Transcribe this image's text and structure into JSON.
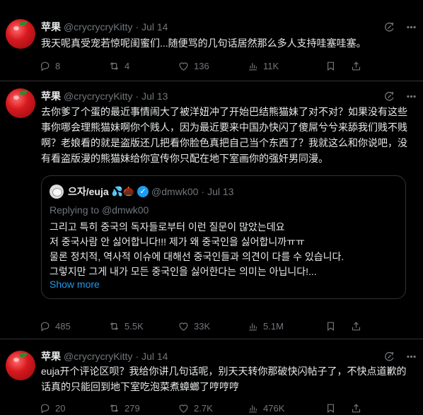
{
  "tweets": [
    {
      "name": "苹果",
      "handle": "@crycrycryKitty",
      "sep": "·",
      "date": "Jul 14",
      "text": "我天呢真受宠若惊呢闺蜜们...随便骂的几句话居然那么多人支持哇塞哇塞。",
      "replies": "8",
      "retweets": "4",
      "likes": "136",
      "views": "11K"
    },
    {
      "name": "苹果",
      "handle": "@crycrycryKitty",
      "sep": "·",
      "date": "Jul 13",
      "text": "去你爹了个蛋的最近事情闹大了被洋妞冲了开始巴结熊猫妹了对不对？如果没有这些事你哪会理熊猫妹啊你个贱人，因为最近要来中国办快闪了傻屌兮兮来舔我们贱不贱啊？老娘看的就是盗版还几把看你脸色真把自己当个东西了？我就这么和你说吧，没有看盗版漫的熊猫妹给你宣传你只配在地下室画你的强奸男同漫。",
      "quote": {
        "name": "으자/euja",
        "emoji": "💦🌰",
        "handle": "@dmwk00",
        "sep": "·",
        "date": "Jul 13",
        "reply_prefix": "Replying to",
        "reply_to": "@dmwk00",
        "lines": [
          "그리고 특히 중국의 독자들로부터 이런 질문이 많았는데요",
          "저 중국사람 안 싫어합니다!!! 제가 왜 중국인을 싫어합니까ㅠㅠ",
          "물론 정치적, 역사적 이슈에 대해선 중국인들과 의견이 다를 수 있습니다.",
          "그렇지만 그게 내가 모든 중국인을 싫어한다는 의미는 아닙니다!..."
        ],
        "show_more": "Show more"
      },
      "replies": "485",
      "retweets": "5.5K",
      "likes": "33K",
      "views": "5.1M"
    },
    {
      "name": "苹果",
      "handle": "@crycrycryKitty",
      "sep": "·",
      "date": "Jul 14",
      "text": "euja开个评论区呗？我给你讲几句话呢，别天天转你那破快闪帖子了，不快点道歉的话真的只能回到地下室吃泡菜煮蟑螂了哼哼哼",
      "replies": "20",
      "retweets": "279",
      "likes": "2.7K",
      "views": "476K"
    }
  ],
  "icons": {
    "reply": "reply-icon",
    "retweet": "retweet-icon",
    "like": "heart-icon",
    "views": "views-icon",
    "bookmark": "bookmark-icon",
    "share": "share-icon",
    "grok": "grok-icon",
    "more": "more-icon"
  },
  "colors": {
    "background": "#000000",
    "text": "#e7e9ea",
    "muted": "#71767b",
    "border": "#2f3336",
    "link": "#1d9bf0"
  }
}
